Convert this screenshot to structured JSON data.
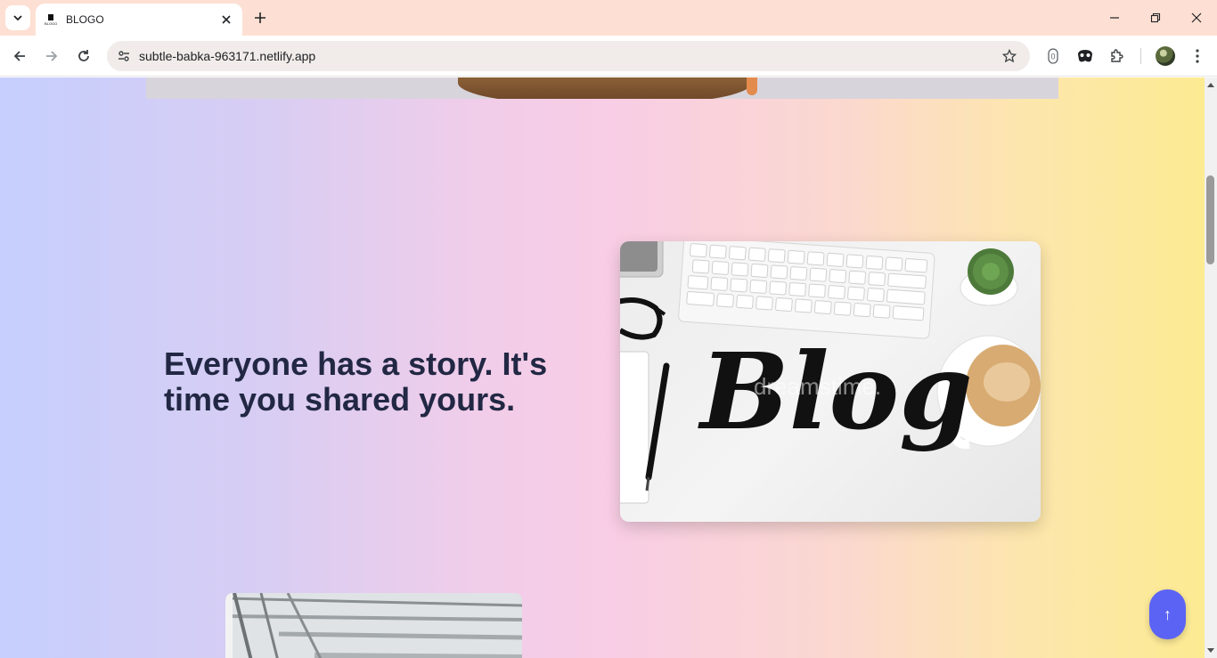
{
  "browser": {
    "tab_title": "BLOGO",
    "favicon_text": "BLOGO",
    "url": "subtle-babka-963171.netlify.app"
  },
  "hero": {
    "heading": "Everyone has a story. It's time you shared yours."
  },
  "blog_image": {
    "script_text": "Blog",
    "watermark": "dreamstime."
  },
  "scroll_top_label": "↑",
  "colors": {
    "heading": "#222844",
    "scroll_button": "#5b63f4",
    "tabstrip": "#fde0d3"
  }
}
